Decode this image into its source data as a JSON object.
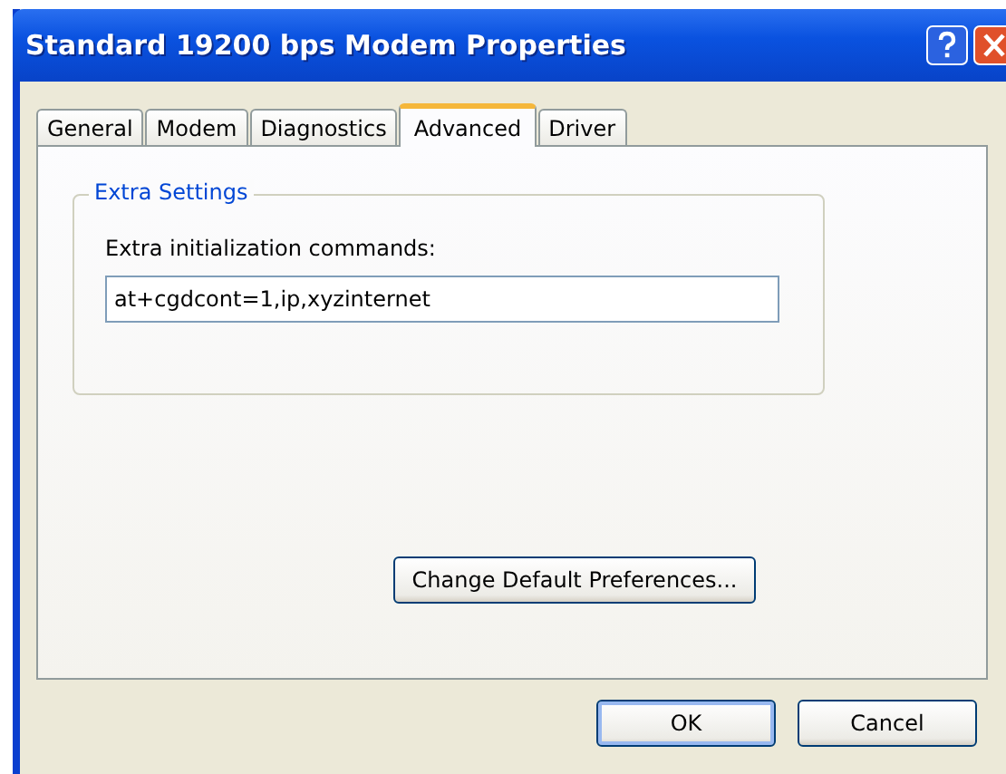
{
  "window": {
    "title": "Standard 19200 bps Modem Properties"
  },
  "tabs": [
    {
      "label": "General",
      "selected": false
    },
    {
      "label": "Modem",
      "selected": false
    },
    {
      "label": "Diagnostics",
      "selected": false
    },
    {
      "label": "Advanced",
      "selected": true
    },
    {
      "label": "Driver",
      "selected": false
    }
  ],
  "group": {
    "title": "Extra Settings",
    "field_label": "Extra initialization commands:",
    "field_value": "at+cgdcont=1,ip,xyzinternet"
  },
  "panel_button": "Change Default Preferences...",
  "buttons": [
    {
      "label": "OK",
      "default": true
    },
    {
      "label": "Cancel",
      "default": false
    }
  ]
}
